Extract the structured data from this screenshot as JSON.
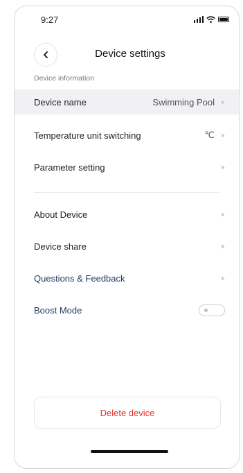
{
  "status_bar": {
    "time": "9:27"
  },
  "header": {
    "title": "Device settings"
  },
  "section_label": "Device information",
  "rows": [
    {
      "label": "Device name",
      "value": "Swimming Pool"
    },
    {
      "label": "Temperature unit switching",
      "value": "℃"
    },
    {
      "label": "Parameter setting",
      "value": ""
    },
    {
      "label": "About Device",
      "value": ""
    },
    {
      "label": "Device share",
      "value": ""
    },
    {
      "label": "Questions & Feedback",
      "value": ""
    },
    {
      "label": "Boost Mode",
      "toggle_on": false
    }
  ],
  "delete_button": {
    "label": "Delete device"
  },
  "colors": {
    "accent_delete": "#e8322b",
    "link_text": "#2a3a66",
    "highlight_row": "#f1f1f4"
  }
}
